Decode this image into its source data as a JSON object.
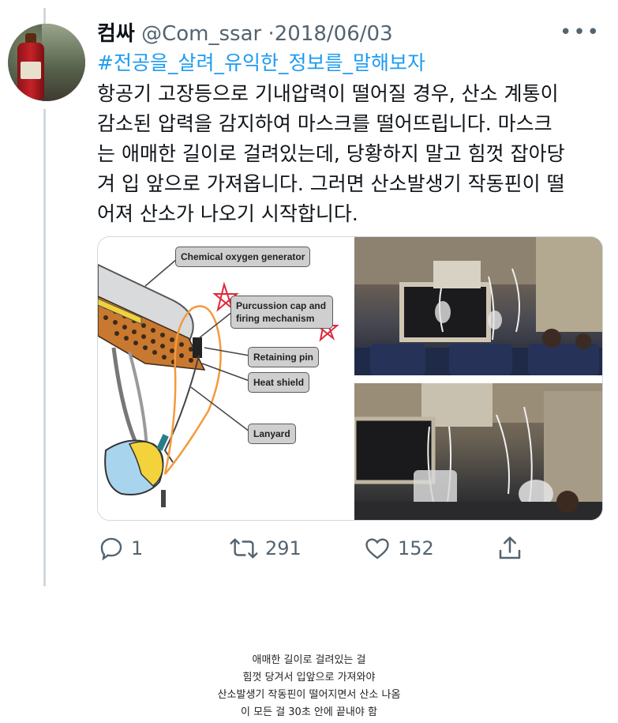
{
  "tweet": {
    "author_name": "컴싸",
    "handle": "@Com_ssar",
    "separator": "·",
    "date": "2018/06/03",
    "more_label": "•••",
    "hashtag": "#전공을_살려_유익한_정보를_말해보자",
    "body_lines": [
      "항공기 고장등으로 기내압력이 떨어질 경우, 산소 계통이",
      "감소된 압력을 감지하여 마스크를 떨어뜨립니다. 마스크",
      "는 애매한 길이로 걸려있는데, 당황하지 말고 힘껏 잡아당",
      "겨 입 앞으로 가져옵니다. 그러면 산소발생기 작동핀이 떨",
      "어져 산소가 나오기 시작합니다."
    ]
  },
  "diagram": {
    "labels": {
      "generator": "Chemical oxygen generator",
      "percussion_line1": "Purcussion cap and",
      "percussion_line2": "firing mechanism",
      "retaining_pin": "Retaining pin",
      "heat_shield": "Heat shield",
      "lanyard": "Lanyard"
    }
  },
  "actions": {
    "reply_count": "1",
    "retweet_count": "291",
    "like_count": "152"
  },
  "caption_lines": [
    "애매한 길이로 걸려있는 걸",
    "힘껏 당겨서 입앞으로 가져와야",
    "산소발생기 작동핀이 떨어지면서 산소 나옴",
    "이 모든 걸 30초 안에 끝내야 함"
  ],
  "colors": {
    "link": "#1d9bf0",
    "secondary_text": "#536471",
    "thread_line": "#cfd9de",
    "annotation_red": "#e0283c",
    "annotation_orange": "#f39a3c"
  }
}
